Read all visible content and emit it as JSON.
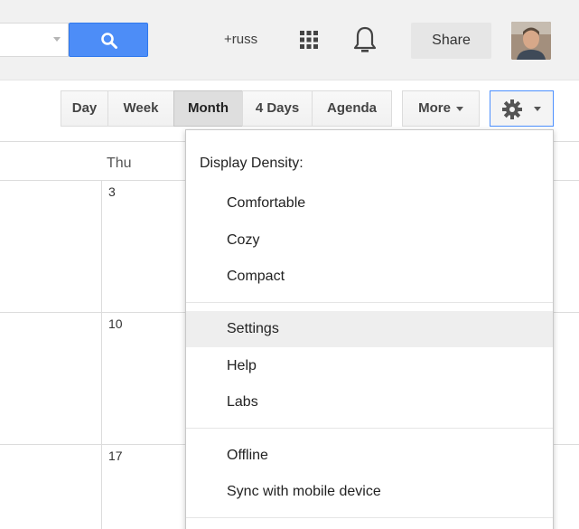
{
  "header": {
    "user_label": "+russ",
    "share_label": "Share"
  },
  "icons": {
    "search": "search-icon",
    "apps": "apps-grid-icon",
    "notifications": "bell-icon",
    "settings": "gear-icon",
    "search_dropdown": "chevron-down-icon"
  },
  "colors": {
    "search_button": "#4d8df7",
    "focus_border": "#4d90fe",
    "active_view": "#dedede",
    "hover_row": "#eeeeee"
  },
  "view_buttons": {
    "day": "Day",
    "week": "Week",
    "month": "Month",
    "four_days": "4 Days",
    "agenda": "Agenda",
    "more": "More",
    "active": "Month"
  },
  "calendar": {
    "day_header": "Thu",
    "dates": [
      "3",
      "10",
      "17"
    ]
  },
  "settings_menu": {
    "heading": "Display Density:",
    "density_options": [
      "Comfortable",
      "Cozy",
      "Compact"
    ],
    "main_items": [
      "Settings",
      "Help",
      "Labs"
    ],
    "extra_items": [
      "Offline",
      "Sync with mobile device"
    ],
    "hovered_item": "Settings"
  }
}
